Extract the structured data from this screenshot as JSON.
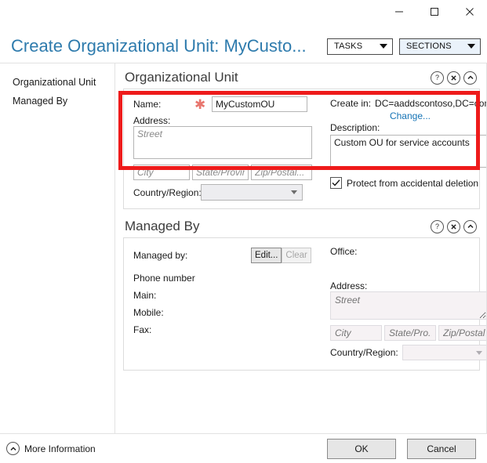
{
  "window": {
    "minimize_label": "Minimize",
    "maximize_label": "Maximize",
    "close_label": "Close"
  },
  "header": {
    "title": "Create Organizational Unit: MyCusto...",
    "tasks_label": "TASKS",
    "sections_label": "SECTIONS"
  },
  "sidebar": {
    "items": [
      {
        "label": "Organizational Unit"
      },
      {
        "label": "Managed By"
      }
    ]
  },
  "sections": {
    "organizational_unit": {
      "title": "Organizational Unit",
      "help_glyph": "?",
      "name_label": "Name:",
      "required_glyph": "✱",
      "name_value": "MyCustomOU",
      "name_placeholder": "",
      "address_label": "Address:",
      "street_placeholder": "Street",
      "street_value": "",
      "city_placeholder": "City",
      "city_value": "",
      "state_placeholder": "State/Provin...",
      "state_value": "",
      "zip_placeholder": "Zip/Postal...",
      "zip_value": "",
      "country_label": "Country/Region:",
      "country_value": "",
      "create_in_label": "Create in:",
      "create_in_value": "DC=aaddscontoso,DC=com",
      "change_link": "Change...",
      "description_label": "Description:",
      "description_value": "Custom OU for service accounts",
      "protect_checkbox_label": "Protect from accidental deletion",
      "protect_checked": true
    },
    "managed_by": {
      "title": "Managed By",
      "help_glyph": "?",
      "managed_by_label": "Managed by:",
      "edit_label": "Edit...",
      "clear_label": "Clear",
      "office_label": "Office:",
      "office_value": "",
      "phone_number_label": "Phone number",
      "main_label": "Main:",
      "main_value": "",
      "mobile_label": "Mobile:",
      "mobile_value": "",
      "fax_label": "Fax:",
      "fax_value": "",
      "address_label": "Address:",
      "street_placeholder": "Street",
      "city_placeholder": "City",
      "state_placeholder": "State/Pro...",
      "zip_placeholder": "Zip/Postal...",
      "country_label": "Country/Region:"
    }
  },
  "footer": {
    "more_information_label": "More Information",
    "ok_label": "OK",
    "cancel_label": "Cancel"
  },
  "colors": {
    "title_blue": "#2e7bad",
    "link_blue": "#1573b5",
    "highlight_red": "#ee1b1b",
    "required_asterisk": "#e8766e",
    "sections_highlight": "#eaf2fa"
  }
}
